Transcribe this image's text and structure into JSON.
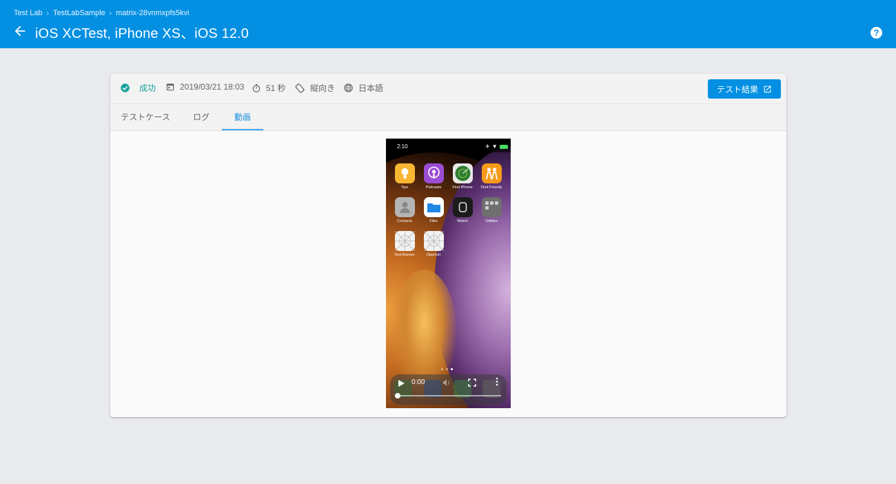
{
  "breadcrumb": [
    "Test Lab",
    "TestLabSample",
    "matrix-28vnmxpfs5kvi"
  ],
  "header": {
    "title": "iOS XCTest, iPhone XS、iOS 12.0",
    "help_icon": "help-circle-icon"
  },
  "summary": {
    "status": "成功",
    "status_color": "#1ba29a",
    "datetime": "2019/03/21 18:03",
    "duration": "51 秒",
    "orientation": "縦向き",
    "locale": "日本語",
    "result_button": "テスト結果",
    "accent_color": "#0390e3"
  },
  "tabs": [
    {
      "label": "テストケース",
      "active": false
    },
    {
      "label": "ログ",
      "active": false
    },
    {
      "label": "動画",
      "active": true
    }
  ],
  "video": {
    "status_time": "2:10",
    "current_time": "0:00",
    "progress": 0.0,
    "page_dots": 3,
    "active_dot": 3,
    "apps": [
      {
        "label": "Tips",
        "icon": "lightbulb-icon",
        "color": "#f7b733"
      },
      {
        "label": "Podcasts",
        "icon": "podcast-icon",
        "color": "#9b4dd4"
      },
      {
        "label": "Find iPhone",
        "icon": "radar-icon",
        "color": "#2e7d32"
      },
      {
        "label": "Find Friends",
        "icon": "friends-icon",
        "color": "#f59b1a"
      },
      {
        "label": "Contacts",
        "icon": "contacts-icon",
        "color": "#a8a8a8"
      },
      {
        "label": "Files",
        "icon": "folder-icon",
        "color": "#ffffff"
      },
      {
        "label": "Watch",
        "icon": "watch-icon",
        "color": "#1c1c1c"
      },
      {
        "label": "Utilities",
        "icon": "utilities-folder-icon",
        "color": "#6f6f6f"
      },
      {
        "label": "Test Runner",
        "icon": "placeholder-icon",
        "color": "#f2f2f2"
      },
      {
        "label": "OpenUrl",
        "icon": "placeholder-icon",
        "color": "#f2f2f2"
      }
    ],
    "dock_icons": [
      "phone-icon",
      "safari-icon",
      "messages-icon",
      "music-icon"
    ]
  }
}
